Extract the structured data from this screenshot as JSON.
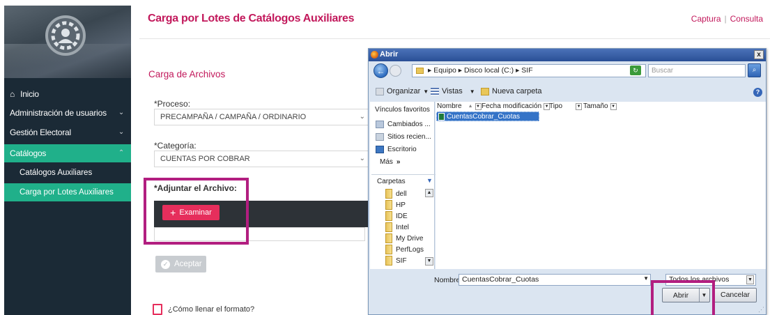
{
  "sidebar": {
    "items": [
      {
        "label": "Inicio"
      },
      {
        "label": "Administración de usuarios"
      },
      {
        "label": "Gestión Electoral"
      },
      {
        "label": "Catálogos"
      },
      {
        "label": "Catálogos Auxiliares"
      },
      {
        "label": "Carga por Lotes Auxiliares"
      }
    ],
    "active_color": "#20b08a",
    "bg_color": "#1b2a36"
  },
  "header": {
    "title": "Carga por Lotes de Catálogos Auxiliares",
    "link_captura": "Captura",
    "separator": "|",
    "link_consulta": "Consulta",
    "accent": "#c2185b"
  },
  "form": {
    "section_title": "Carga de Archivos",
    "proceso_label": "*Proceso:",
    "proceso_value": "PRECAMPAÑA / CAMPAÑA / ORDINARIO",
    "categoria_label": "*Categoría:",
    "categoria_value": "CUENTAS POR COBRAR",
    "adjuntar_label": "*Adjuntar el Archivo:",
    "browse_label": "Examinar",
    "accept_label": "Aceptar",
    "help_text": "¿Cómo llenar el formato?"
  },
  "dialog": {
    "title": "Abrir",
    "close": "x",
    "breadcrumb": "▸ Equipo ▸ Disco local (C:) ▸ SIF",
    "search_placeholder": "Buscar",
    "toolbar": {
      "organize": "Organizar",
      "views": "Vistas",
      "new_folder": "Nueva carpeta"
    },
    "nav": {
      "favorites_title": "Vínculos favoritos",
      "favorites": [
        "Cambiados ...",
        "Sitios recien...",
        "Escritorio",
        "Más"
      ],
      "folders_title": "Carpetas",
      "folders": [
        "dell",
        "HP",
        "IDE",
        "Intel",
        "My Drive",
        "PerfLogs",
        "SIF"
      ]
    },
    "columns": [
      "Nombre",
      "Fecha modificación",
      "Tipo",
      "Tamaño"
    ],
    "files": [
      {
        "name": "CuentasCobrar_Cuotas",
        "selected": true
      }
    ],
    "name_label": "Nombre:",
    "name_value": "CuentasCobrar_Cuotas",
    "filter_value": "Todos los archivos",
    "open_label": "Abrir",
    "cancel_label": "Cancelar"
  }
}
